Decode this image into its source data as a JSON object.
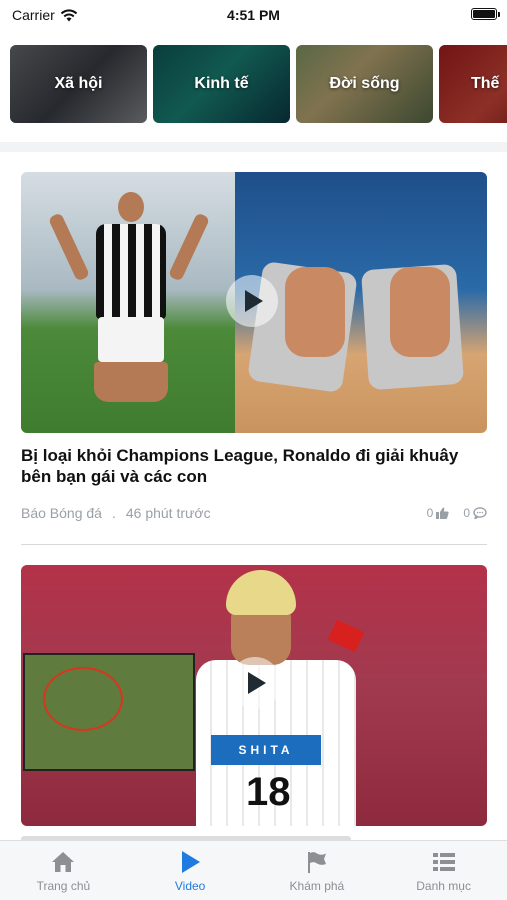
{
  "status_bar": {
    "carrier": "Carrier",
    "time": "4:51 PM"
  },
  "categories": [
    {
      "label": "Xã hội"
    },
    {
      "label": "Kinh tế"
    },
    {
      "label": "Đời sống"
    },
    {
      "label": "Thế"
    }
  ],
  "articles": [
    {
      "title": "Bị loại khỏi Champions League, Ronaldo đi giải khuây bên bạn gái và các con",
      "source": "Báo Bóng đá",
      "time_ago": "46 phút trước",
      "likes": "0",
      "comments": "0"
    },
    {
      "inset_text": "SHITA",
      "jersey_number": "18"
    }
  ],
  "tab_bar": {
    "tabs": [
      {
        "label": "Trang chủ",
        "icon": "home-icon"
      },
      {
        "label": "Video",
        "icon": "play-icon",
        "active": true
      },
      {
        "label": "Khám phá",
        "icon": "flag-icon"
      },
      {
        "label": "Danh mục",
        "icon": "list-icon"
      }
    ]
  },
  "colors": {
    "accent": "#1f7be0",
    "inactive": "#8e8e93",
    "meta_text": "#9aa0a6"
  }
}
